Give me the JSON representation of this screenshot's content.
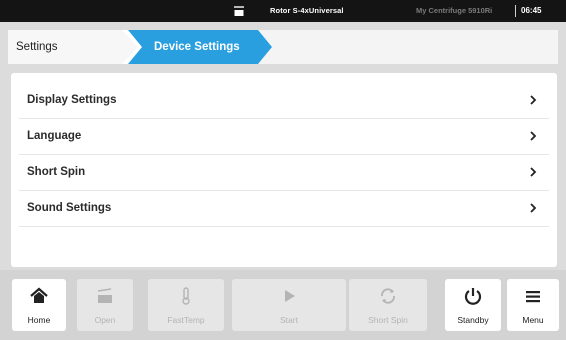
{
  "status_bar": {
    "rotor_icon": "rotor-bucket-icon",
    "rotor_label": "Rotor S-4xUniversal",
    "device_name": "My Centrifuge 5910Ri",
    "clock": "06:45"
  },
  "breadcrumb": {
    "items": [
      {
        "label": "Settings"
      },
      {
        "label": "Device Settings"
      }
    ],
    "active_color": "#2a9fe0"
  },
  "settings_list": {
    "items": [
      {
        "label": "Display Settings",
        "icon": "chevron-right-icon"
      },
      {
        "label": "Language",
        "icon": "chevron-right-icon"
      },
      {
        "label": "Short Spin",
        "icon": "chevron-right-icon"
      },
      {
        "label": "Sound Settings",
        "icon": "chevron-right-icon"
      }
    ]
  },
  "toolbar": {
    "buttons": [
      {
        "label": "Home",
        "icon": "home-icon",
        "enabled": true
      },
      {
        "label": "Open",
        "icon": "lid-open-icon",
        "enabled": false
      },
      {
        "label": "FastTemp",
        "icon": "thermometer-icon",
        "enabled": false
      },
      {
        "label": "Start",
        "icon": "play-icon",
        "enabled": false
      },
      {
        "label": "Short Spin",
        "icon": "short-spin-icon",
        "enabled": false
      },
      {
        "label": "Standby",
        "icon": "power-icon",
        "enabled": true
      },
      {
        "label": "Menu",
        "icon": "menu-icon",
        "enabled": true
      }
    ]
  }
}
